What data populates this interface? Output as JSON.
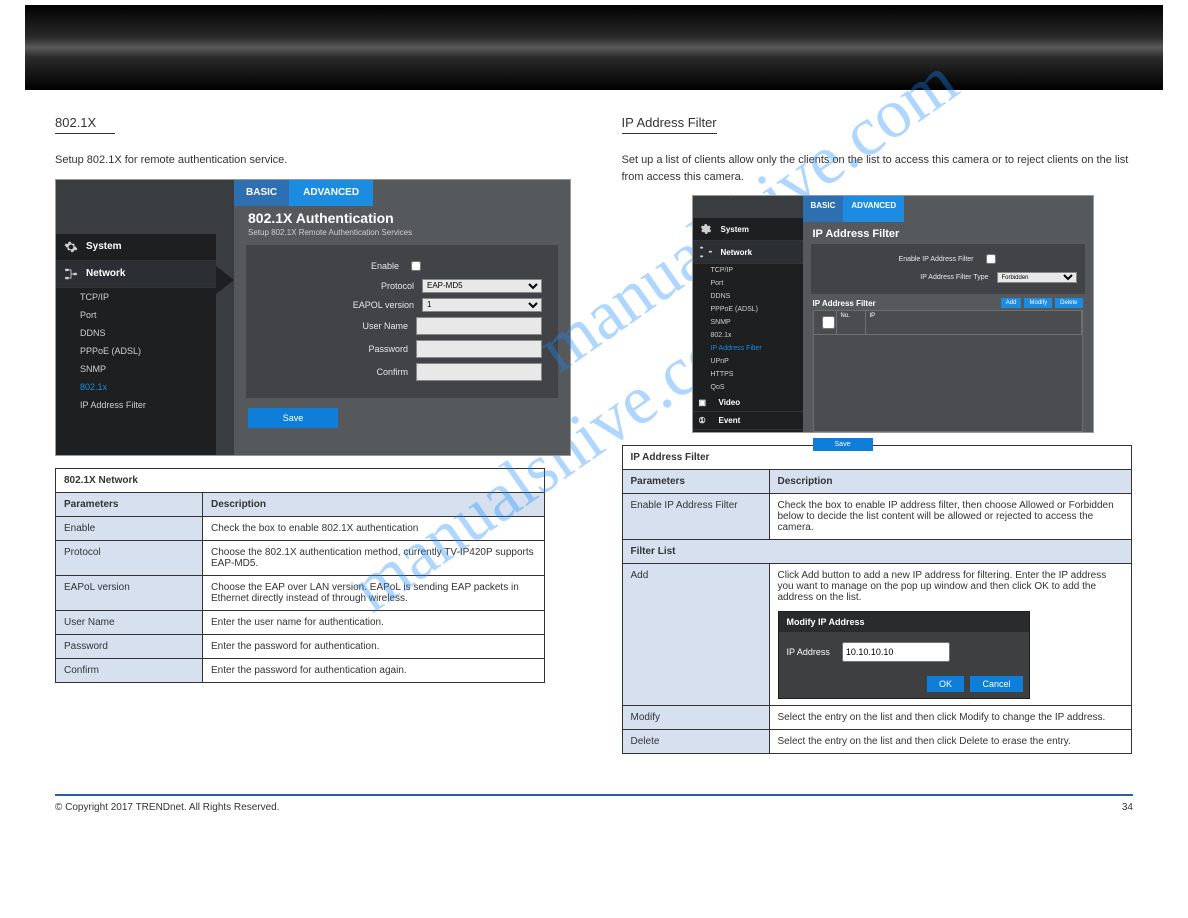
{
  "left": {
    "section": "802.1X",
    "intro": "Setup 802.1X for remote authentication service.",
    "tabs": {
      "basic": "BASIC",
      "advanced": "ADVANCED"
    },
    "panel_title": "802.1X Authentication",
    "panel_sub": "Setup 802.1X Remote Authentication Services",
    "sidebar": {
      "system": "System",
      "network": "Network",
      "items": [
        "TCP/IP",
        "Port",
        "DDNS",
        "PPPoE (ADSL)",
        "SNMP",
        "802.1x",
        "IP Address Filter"
      ]
    },
    "form": {
      "enable": "Enable",
      "protocol": "Protocol",
      "protocol_val": "EAP-MD5",
      "eapol": "EAPOL version",
      "eapol_val": "1",
      "user": "User Name",
      "pass": "Password",
      "confirm": "Confirm",
      "save": "Save"
    },
    "table_title": "802.1X Network",
    "rows": {
      "p": "Parameters",
      "d": "Description",
      "enable_l": "Enable",
      "enable_d": "Check the box to enable 802.1X authentication",
      "protocol_l": "Protocol",
      "protocol_d": "Choose the 802.1X authentication method, currently TV-IP420P supports EAP-MD5.",
      "eapol_l": "EAPoL version",
      "eapol_d": "Choose the EAP over LAN version. EAPoL is sending EAP packets in Ethernet directly instead of through wireless.",
      "user_l": "User Name",
      "user_d": "Enter the user name for authentication.",
      "pass_l": "Password",
      "pass_d": "Enter the password for authentication.",
      "conf_l": "Confirm",
      "conf_d": "Enter the password for authentication again."
    }
  },
  "right": {
    "section": "IP Address Filter",
    "intro": "Set up a list of clients allow only the clients on the list to access this camera or to reject clients on the list from access this camera.",
    "tabs": {
      "basic": "BASIC",
      "advanced": "ADVANCED"
    },
    "panel_title": "IP Address Filter",
    "form": {
      "enable": "Enable IP Address Filter",
      "type": "IP Address Filter Type",
      "type_val": "Forbidden",
      "list": "IP Address Filter",
      "no": "No.",
      "ip": "IP",
      "add": "Add",
      "modify": "Modify",
      "delete": "Delete",
      "save": "Save"
    },
    "sidebar": {
      "system": "System",
      "network": "Network",
      "items": [
        "TCP/IP",
        "Port",
        "DDNS",
        "PPPoE (ADSL)",
        "SNMP",
        "802.1x",
        "IP Address Filter",
        "UPnP",
        "HTTPS",
        "QoS"
      ],
      "video": "Video",
      "event": "Event"
    },
    "table_title": "IP Address Filter",
    "rows": {
      "p": "Parameters",
      "d": "Description",
      "enable_l": "Enable IP Address Filter",
      "enable_d": "Check the box to enable IP address filter, then choose Allowed or Forbidden below to decide the list content will be allowed or rejected to access the camera.",
      "list_l": "Filter List",
      "add_l": "Add",
      "add_d": "Click Add button to add a new IP address for filtering. Enter the IP address you want to manage on the pop up window and then click OK to add the address on the list.",
      "mod_l": "Modify",
      "mod_d": "Select the entry on the list and then click Modify to change the IP address.",
      "del_l": "Delete",
      "del_d": "Select the entry on the list and then click Delete to erase the entry."
    },
    "dialog": {
      "title": "Modify IP Address",
      "label": "IP Address",
      "value": "10.10.10.10",
      "ok": "OK",
      "cancel": "Cancel"
    }
  },
  "footer": {
    "copy": "© Copyright 2017 TRENDnet. All Rights Reserved.",
    "page": "34"
  },
  "wm": "manualshive.com"
}
